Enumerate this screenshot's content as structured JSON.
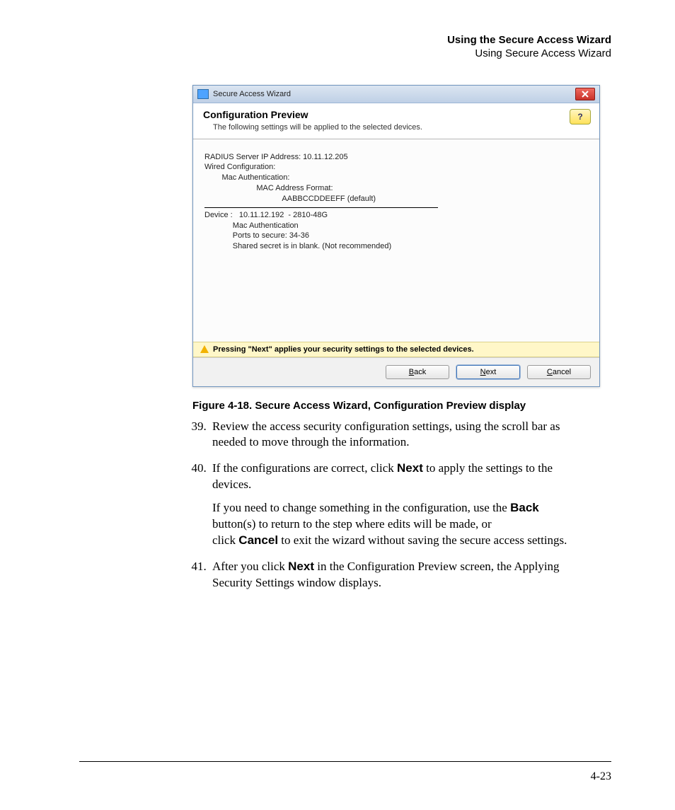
{
  "running_head": {
    "bold": "Using the Secure Access Wizard",
    "reg": "Using Secure Access Wizard"
  },
  "wizard": {
    "title": "Secure Access Wizard",
    "header_title": "Configuration Preview",
    "header_sub": "The following settings will be applied to the selected devices.",
    "help_glyph": "?",
    "config_lines": [
      "RADIUS Server IP Address: 10.11.12.205",
      "Wired Configuration:",
      "        Mac Authentication:",
      "                        MAC Address Format:",
      "                                    AABBCCDDEEFF (default)"
    ],
    "device_lines": [
      "Device :   10.11.12.192  - 2810-48G",
      "             Mac Authentication",
      "             Ports to secure: 34-36",
      "             Shared secret is in blank. (Not recommended)"
    ],
    "info_msg": "Pressing \"Next\" applies your security settings to the selected devices.",
    "buttons": {
      "back": "Back",
      "next": "Next",
      "cancel": "Cancel"
    }
  },
  "caption": "Figure 4-18. Secure Access Wizard, Configuration Preview display",
  "steps": {
    "start": 39,
    "s39": "Review the access security configuration settings, using the scroll bar as needed to move through the information.",
    "s40_a": "If the configurations are correct, click ",
    "s40_b": "Next",
    "s40_c": " to apply the settings to the devices.",
    "s40_p_a": "If you need to change something in the configuration, use the ",
    "s40_p_b": "Back",
    "s40_p_c": " button(s) to return to the step where edits will be made, or",
    "s40_p_d": "click ",
    "s40_p_e": "Cancel",
    "s40_p_f": " to exit the wizard without saving the secure access settings.",
    "s41_a": "After you click ",
    "s41_b": "Next",
    "s41_c": " in the Configuration Preview screen, the Applying Security Settings window displays."
  },
  "page_number": "4-23"
}
